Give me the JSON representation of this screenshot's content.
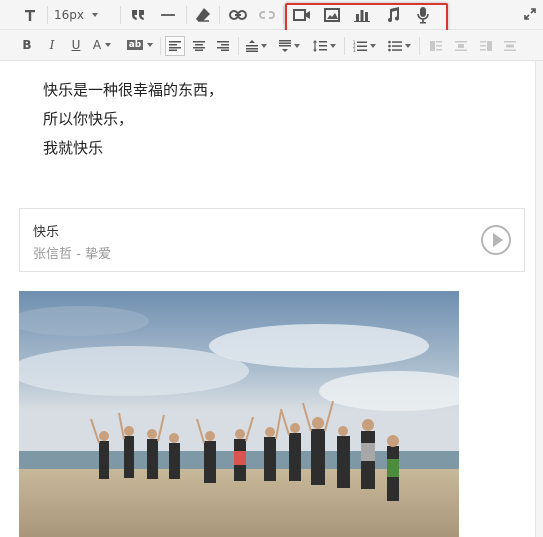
{
  "toolbar": {
    "font_size": "16px",
    "icons": {
      "text_style": "text-style-icon",
      "quote": "quote-icon",
      "horizontal_rule": "horizontal-rule-icon",
      "clear_format": "eraser-icon",
      "link": "link-icon",
      "unlink": "unlink-icon",
      "video": "video-icon",
      "image": "image-icon",
      "chart": "chart-icon",
      "music": "music-icon",
      "voice": "microphone-icon",
      "fullscreen": "expand-icon"
    },
    "format_labels": {
      "bold": "B",
      "italic": "I",
      "underline": "U",
      "font_color": "A",
      "bg_color": "ab"
    },
    "highlight_color": "#d9362f"
  },
  "editor": {
    "lines": [
      "快乐是一种很幸福的东西，",
      "所以你快乐，",
      "我就快乐"
    ],
    "music": {
      "title": "快乐",
      "subtitle": "张信哲 - 挚爱"
    }
  }
}
